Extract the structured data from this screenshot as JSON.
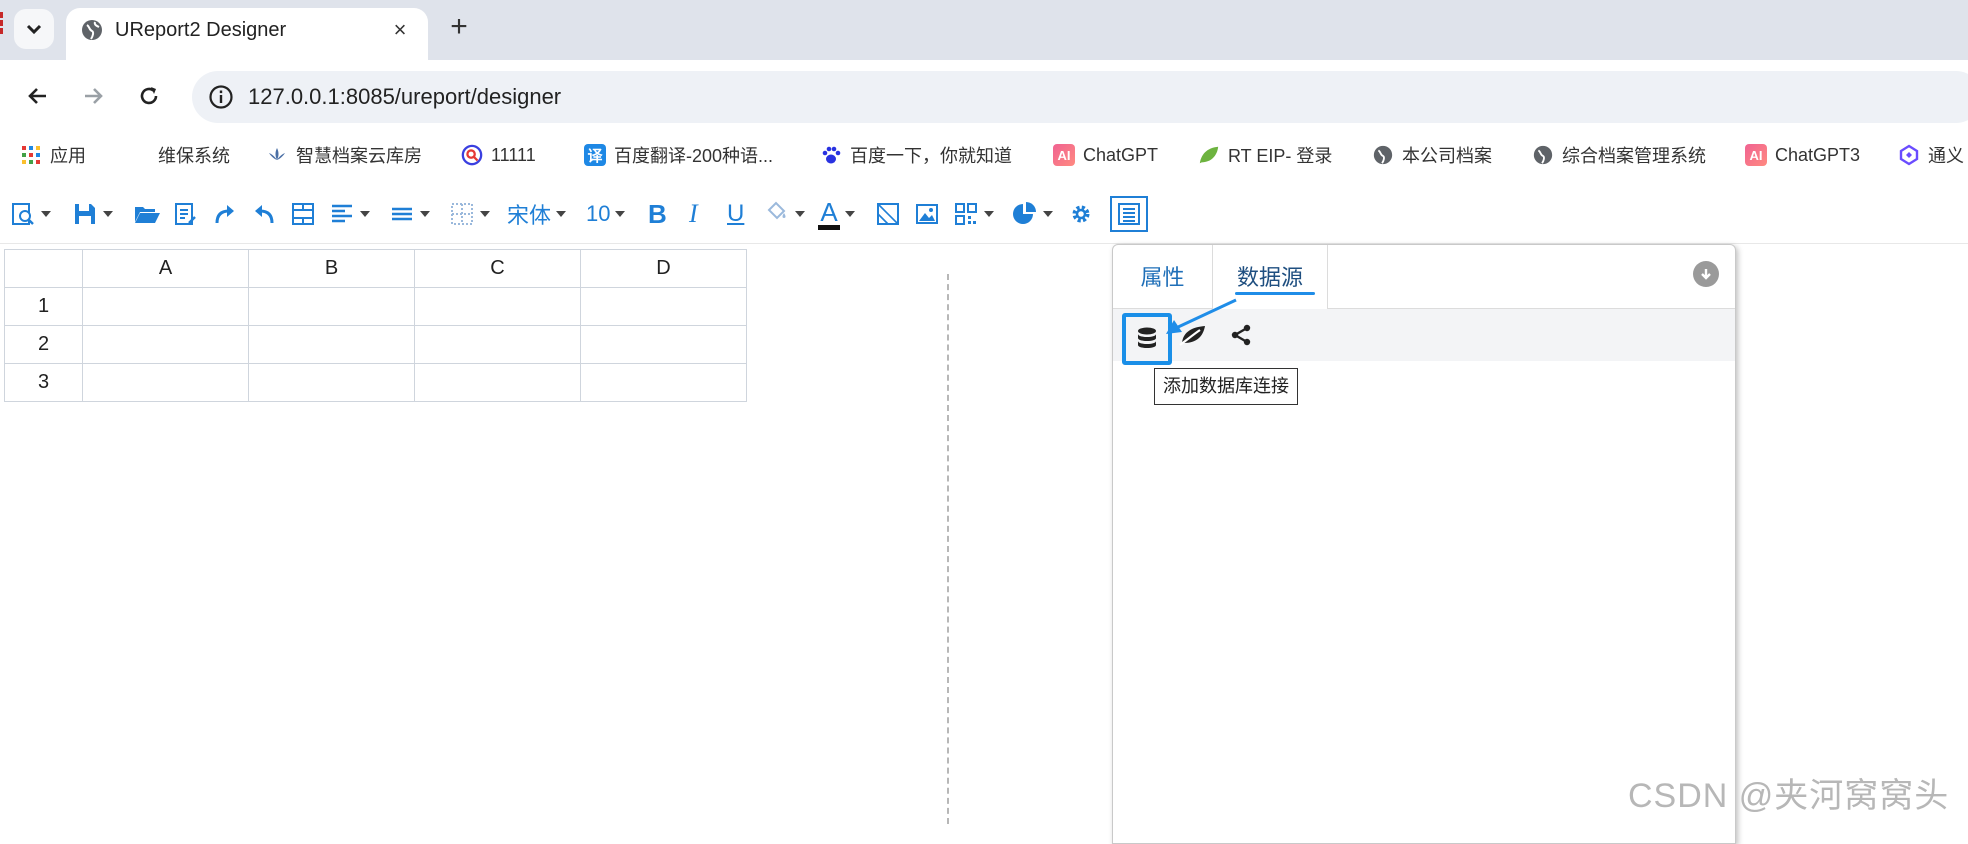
{
  "browser": {
    "tab_title": "UReport2 Designer",
    "tab_close": "×",
    "new_tab": "+",
    "url": "127.0.0.1:8085/ureport/designer"
  },
  "bookmarks": [
    {
      "label": "应用",
      "icon": "apps-grid-icon"
    },
    {
      "label": "维保系统",
      "icon": ""
    },
    {
      "label": "智慧档案云库房",
      "icon": "lotus-icon"
    },
    {
      "label": "11111",
      "icon": "search-circle-icon"
    },
    {
      "label": "百度翻译-200种语...",
      "icon": "translate-icon"
    },
    {
      "label": "百度一下，你就知道",
      "icon": "paw-icon"
    },
    {
      "label": "ChatGPT",
      "icon": "ai-icon"
    },
    {
      "label": "RT EIP- 登录",
      "icon": "leaf-icon"
    },
    {
      "label": "本公司档案",
      "icon": "globe-icon"
    },
    {
      "label": "综合档案管理系统",
      "icon": "globe-icon"
    },
    {
      "label": "ChatGPT3",
      "icon": "ai-icon"
    },
    {
      "label": "通义",
      "icon": "tongyi-icon"
    }
  ],
  "toolbar": {
    "font_name": "宋体",
    "font_size": "10",
    "bold": "B",
    "italic": "I",
    "underline": "U",
    "font_color_letter": "A"
  },
  "grid": {
    "columns": [
      "A",
      "B",
      "C",
      "D"
    ],
    "rows": [
      "1",
      "2",
      "3"
    ]
  },
  "panel": {
    "tabs": [
      "属性",
      "数据源"
    ],
    "active_tab": "数据源",
    "tooltip": "添加数据库连接"
  },
  "watermark": "CSDN @夹河窝窝头",
  "colors": {
    "accent": "#1f8de8",
    "toolbar_icon": "#1f7fd6",
    "tab_strip": "#dfe3eb"
  }
}
